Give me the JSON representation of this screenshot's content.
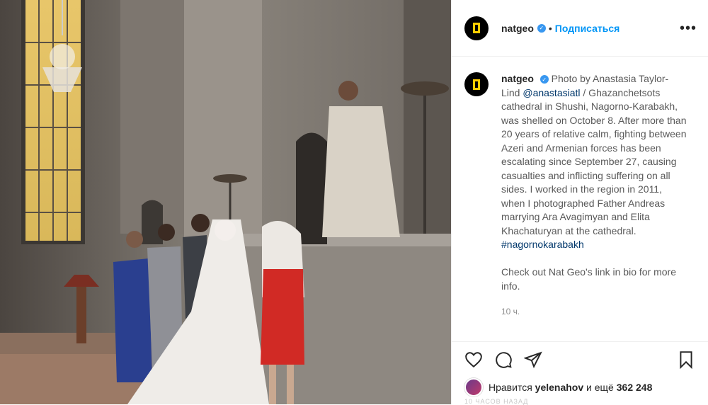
{
  "post": {
    "author": "natgeo",
    "follow_label": "Подписаться",
    "more_label": "•••",
    "caption": {
      "author": "natgeo",
      "text_before_mention": "Photo by Anastasia Taylor-Lind ",
      "mention": "@anastasiatl",
      "text_after_mention": " / Ghazanchetsots cathedral in Shushi, Nagorno-Karabakh, was shelled on October 8. After more than 20 years of relative calm, fighting between Azeri and Armenian forces has been escalating since September 27, causing casualties and inflicting suffering on all sides. I worked in the region in 2011, when I photographed Father Andreas marrying Ara Avagimyan and Elita Khachaturyan at the cathedral. ",
      "hashtag": "#nagornokarabakh",
      "closing": "Check out Nat Geo's link in bio for more info."
    },
    "time_ago": "10 ч.",
    "likes": {
      "prefix": "Нравится ",
      "user": "yelenahov",
      "middle": " и ещё ",
      "count": "362 248"
    },
    "below_text": "10 ЧАСОВ НАЗАД"
  },
  "icons": [
    "heart-icon",
    "comment-icon",
    "share-icon",
    "bookmark-icon",
    "verified-icon",
    "natgeo-logo"
  ],
  "colors": {
    "link": "#0095f6",
    "verified": "#3897f0",
    "logo_yellow": "#ffcd00"
  }
}
